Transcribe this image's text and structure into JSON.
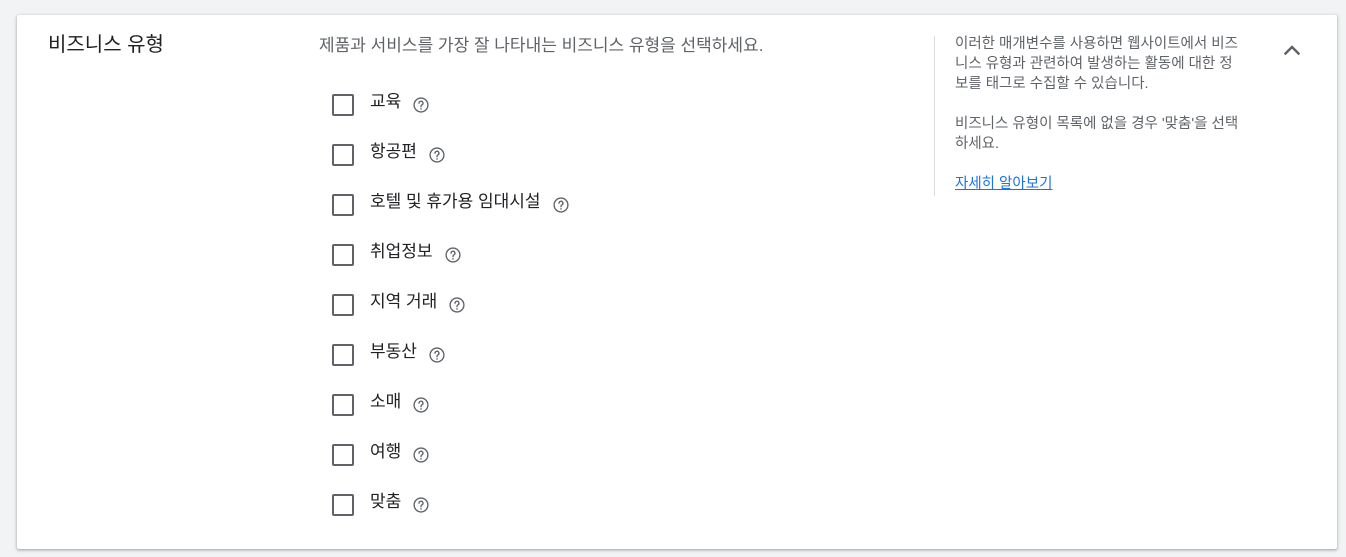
{
  "section": {
    "title": "비즈니스 유형",
    "description": "제품과 서비스를 가장 잘 나타내는 비즈니스 유형을 선택하세요."
  },
  "business_types": [
    {
      "label": "교육",
      "checked": false
    },
    {
      "label": "항공편",
      "checked": false
    },
    {
      "label": "호텔 및 휴가용 임대시설",
      "checked": false
    },
    {
      "label": "취업정보",
      "checked": false
    },
    {
      "label": "지역 거래",
      "checked": false
    },
    {
      "label": "부동산",
      "checked": false
    },
    {
      "label": "소매",
      "checked": false
    },
    {
      "label": "여행",
      "checked": false
    },
    {
      "label": "맞춤",
      "checked": false
    }
  ],
  "side_panel": {
    "paragraph1": "이러한 매개변수를 사용하면 웹사이트에서 비즈니스 유형과 관련하여 발생하는 활동에 대한 정보를 태그로 수집할 수 있습니다.",
    "paragraph2": "비즈니스 유형이 목록에 없을 경우 '맞춤'을 선택하세요.",
    "learn_more": "자세히 알아보기"
  },
  "icons": {
    "help": "help-circle-icon",
    "collapse": "chevron-up-icon"
  },
  "colors": {
    "link": "#1a73e8",
    "secondary_text": "#5f6368",
    "primary_text": "#202124",
    "background": "#f1f3f4"
  }
}
